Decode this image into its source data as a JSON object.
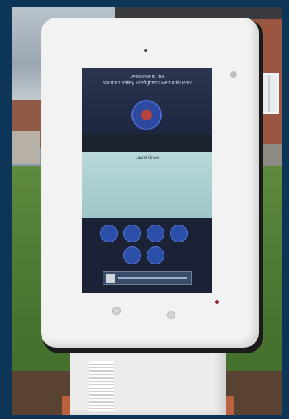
{
  "image": {
    "description_type": "photo",
    "kiosk": {
      "screen": {
        "welcome_text": "Welcome to the",
        "park_name": "Montour Valley Firefighters Memorial Park",
        "band_heading": "Laurel Grove",
        "buttons": [
          "",
          "",
          "",
          "",
          "",
          ""
        ]
      }
    }
  }
}
